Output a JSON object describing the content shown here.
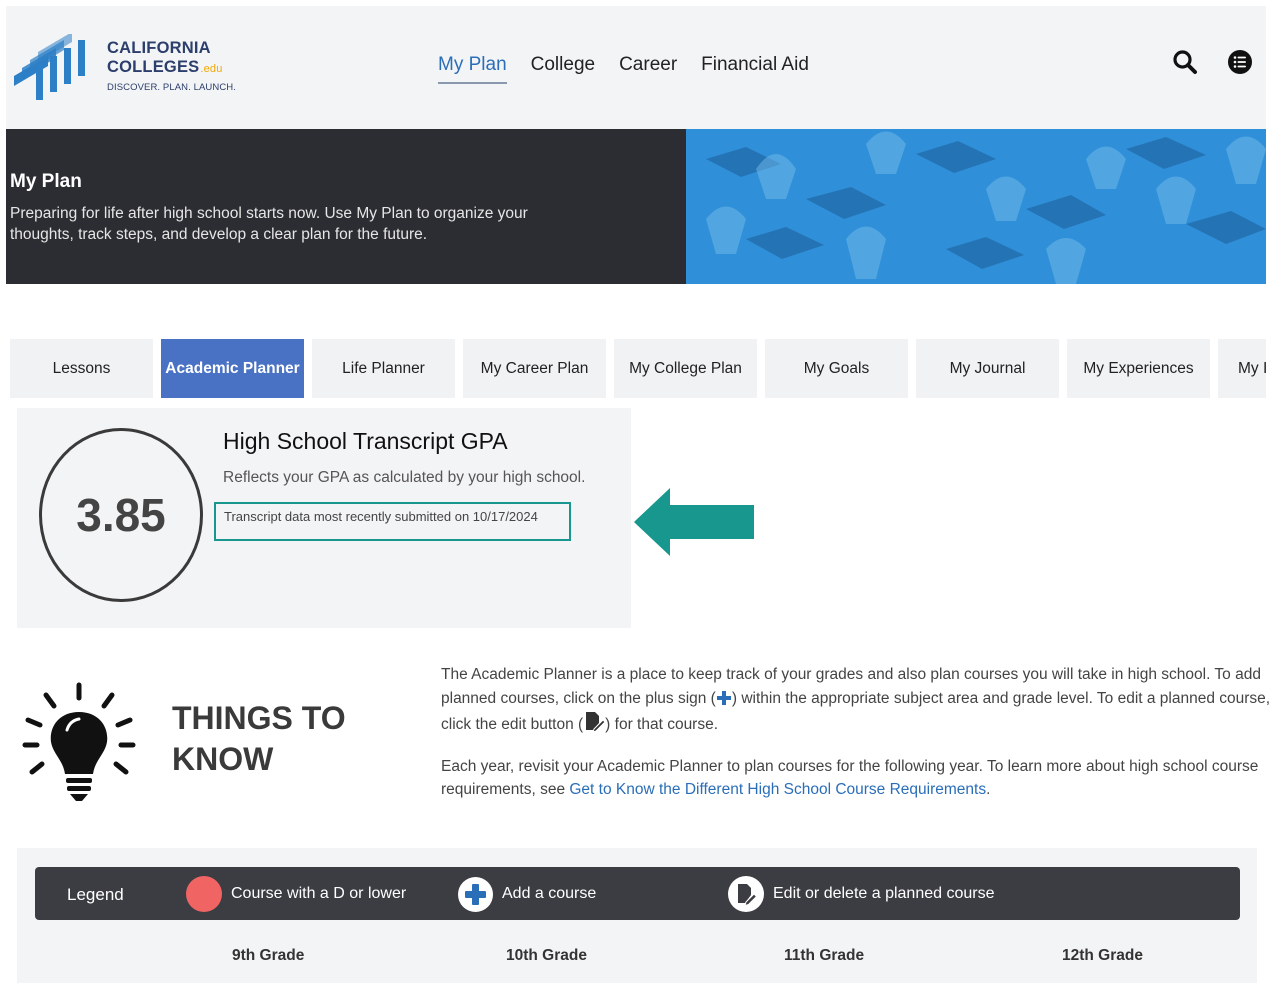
{
  "header": {
    "logo": {
      "line1": "CALIFORNIA",
      "line2": "COLLEGES",
      "edu": ".edu",
      "tagline": "DISCOVER. PLAN. LAUNCH."
    },
    "nav": [
      {
        "label": "My Plan",
        "active": true
      },
      {
        "label": "College",
        "active": false
      },
      {
        "label": "Career",
        "active": false
      },
      {
        "label": "Financial Aid",
        "active": false
      }
    ],
    "icons": {
      "search": "search-icon",
      "menu": "list-menu-icon"
    }
  },
  "hero": {
    "title": "My Plan",
    "description": "Preparing for life after high school starts now. Use My Plan to organize your thoughts, track steps, and develop a clear plan for the future."
  },
  "tabs": [
    {
      "label": "Lessons",
      "active": false
    },
    {
      "label": "Academic Planner",
      "active": true
    },
    {
      "label": "Life Planner",
      "active": false
    },
    {
      "label": "My Career Plan",
      "active": false
    },
    {
      "label": "My College Plan",
      "active": false
    },
    {
      "label": "My Goals",
      "active": false
    },
    {
      "label": "My Journal",
      "active": false
    },
    {
      "label": "My Experiences",
      "active": false
    },
    {
      "label": "My I",
      "active": false
    }
  ],
  "gpa": {
    "value": "3.85",
    "title": "High School Transcript GPA",
    "subtitle": "Reflects your GPA as calculated by your high school.",
    "note": "Transcript data most recently submitted on 10/17/2024"
  },
  "things_to_know": {
    "heading_line1": "THINGS TO",
    "heading_line2": "KNOW",
    "p1_a": "The Academic Planner is a place to keep track of your grades and also plan courses you will take in high school. To add planned courses, click on the plus sign (",
    "p1_b": ") within the appropriate subject area and grade level. To edit a planned course, click the edit button (",
    "p1_c": ") for that course.",
    "p2_a": "Each year, revisit your Academic Planner to plan courses for the following year. To learn more about high school course requirements, see ",
    "p2_link": "Get to Know the Different High School Course Requirements",
    "p2_b": "."
  },
  "legend": {
    "title": "Legend",
    "items": [
      {
        "icon": "red-circle-icon",
        "label": "Course with a D or lower"
      },
      {
        "icon": "plus-circle-icon",
        "label": "Add a course"
      },
      {
        "icon": "edit-document-icon",
        "label": "Edit or delete a planned course"
      }
    ]
  },
  "grades": [
    "9th Grade",
    "10th Grade",
    "11th Grade",
    "12th Grade"
  ],
  "colors": {
    "accent_blue": "#4a72c4",
    "nav_active": "#2a6eb8",
    "teal": "#17978e",
    "legend_red": "#f06464",
    "plus_blue": "#2a6eb8",
    "dark": "#2b2d32"
  }
}
